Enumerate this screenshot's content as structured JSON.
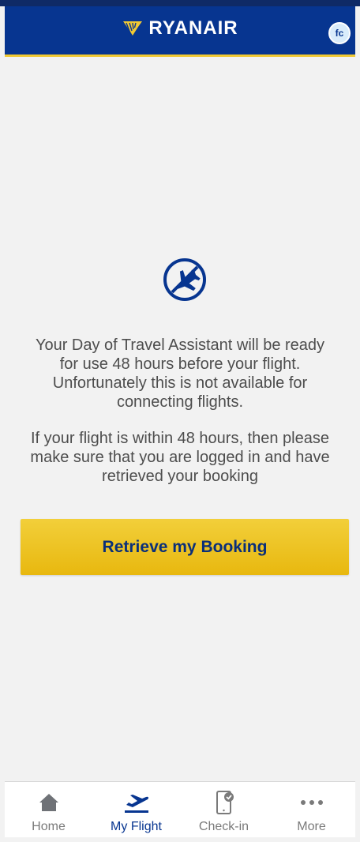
{
  "header": {
    "brand": "RYANAIR",
    "avatar_initials": "fc",
    "colors": {
      "header": "#073590",
      "accent": "#f1c933"
    }
  },
  "main": {
    "icon": "no-flight-icon",
    "message_1": "Your Day of Travel Assistant will be ready for use 48 hours before your flight. Unfortunately this is not available for connecting flights.",
    "message_2": "If your flight is within 48 hours, then please make sure that you are logged in and have retrieved your booking",
    "retrieve_button": "Retrieve my Booking"
  },
  "bottom_nav": {
    "items": [
      {
        "label": "Home",
        "icon": "home-icon",
        "active": false
      },
      {
        "label": "My Flight",
        "icon": "departure-plane-icon",
        "active": true
      },
      {
        "label": "Check-in",
        "icon": "mobile-checkin-icon",
        "active": false
      },
      {
        "label": "More",
        "icon": "more-dots-icon",
        "active": false
      }
    ]
  }
}
